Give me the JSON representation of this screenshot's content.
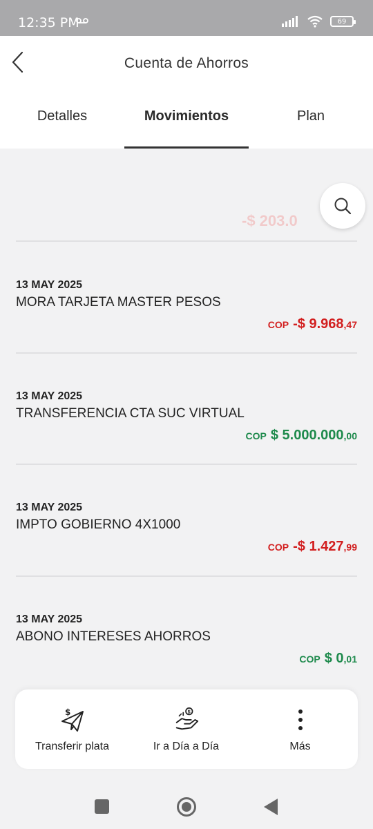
{
  "status_bar": {
    "time": "12:35 PM",
    "battery": "69"
  },
  "header": {
    "title": "Cuenta de Ahorros"
  },
  "tabs": [
    {
      "label": "Detalles",
      "active": false
    },
    {
      "label": "Movimientos",
      "active": true
    },
    {
      "label": "Plan",
      "active": false
    }
  ],
  "transactions": [
    {
      "date": "13 MAY 2025",
      "description": "MORA TARJETA MASTER PESOS",
      "currency": "COP",
      "amount": "-$ 9.968",
      "cents": ",47",
      "type": "negative"
    },
    {
      "date": "13 MAY 2025",
      "description": "TRANSFERENCIA CTA SUC VIRTUAL",
      "currency": "COP",
      "amount": "$ 5.000.000",
      "cents": ",00",
      "type": "positive"
    },
    {
      "date": "13 MAY 2025",
      "description": "IMPTO GOBIERNO 4X1000",
      "currency": "COP",
      "amount": "-$ 1.427",
      "cents": ",99",
      "type": "negative"
    },
    {
      "date": "13 MAY 2025",
      "description": "ABONO INTERESES AHORROS",
      "currency": "COP",
      "amount": "$ 0",
      "cents": ",01",
      "type": "positive"
    }
  ],
  "actions": [
    {
      "label": "Transferir plata",
      "icon": "send-money-icon"
    },
    {
      "label": "Ir a Día a Día",
      "icon": "money-hand-icon"
    },
    {
      "label": "Más",
      "icon": "more-vertical-icon"
    }
  ],
  "colors": {
    "negative": "#d21f1f",
    "positive": "#1e8a4c"
  }
}
